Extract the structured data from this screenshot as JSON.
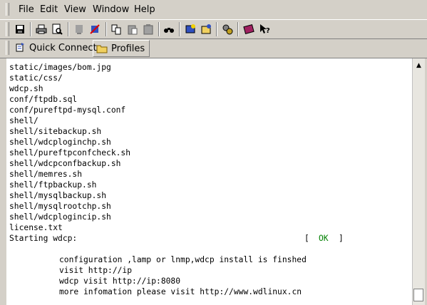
{
  "menu": {
    "file": "File",
    "edit": "Edit",
    "view": "View",
    "window": "Window",
    "help": "Help"
  },
  "toolbar_icons": [
    "save-icon",
    "print-icon",
    "print-preview-icon",
    "disconnect-icon",
    "connect-icon",
    "copy-icon",
    "paste-icon",
    "paste-special-icon",
    "find-icon",
    "new-terminal-icon",
    "new-file-transfer-icon",
    "settings-icon",
    "help-book-icon",
    "context-help-icon"
  ],
  "quickbar": {
    "quick_connect": "Quick Connect",
    "profiles": "Profiles"
  },
  "terminal": {
    "lines": [
      "static/images/bom.jpg",
      "static/css/",
      "wdcp.sh",
      "conf/ftpdb.sql",
      "conf/pureftpd-mysql.conf",
      "shell/",
      "shell/sitebackup.sh",
      "shell/wdcploginchp.sh",
      "shell/pureftpconfcheck.sh",
      "shell/wdcpconfbackup.sh",
      "shell/memres.sh",
      "shell/ftpbackup.sh",
      "shell/mysqlbackup.sh",
      "shell/mysqlrootchp.sh",
      "shell/wdcplogincip.sh",
      "license.txt",
      "Starting wdcp:"
    ],
    "status_open": "[",
    "status_ok": "OK",
    "status_close": "]",
    "info_lines": [
      "configuration ,lamp or lnmp,wdcp install is finshed",
      "visit http://ip",
      "wdcp visit http://ip:8080",
      "more infomation please visit http://www.wdlinux.cn"
    ]
  },
  "colors": {
    "chrome": "#d4d0c8",
    "ok_green": "#008000"
  }
}
